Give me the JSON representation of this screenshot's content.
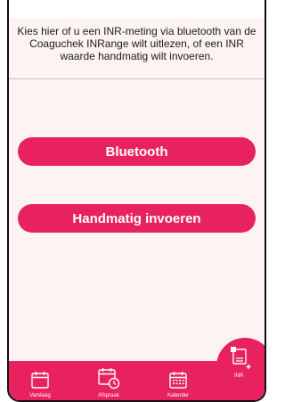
{
  "instruction_text": "Kies hier of u een INR-meting via bluetooth van de Coaguchek INRange wilt uitlezen, of een INR waarde handmatig wilt invoeren.",
  "buttons": {
    "bluetooth_label": "Bluetooth",
    "manual_label": "Handmatig invoeren"
  },
  "nav": {
    "today_label": "Vandaag",
    "appointment_label": "Afspraak",
    "calendar_label": "Kalender",
    "inr_label": "INR"
  },
  "colors": {
    "accent": "#e8215f",
    "background": "#fdf3f3"
  },
  "icons": {
    "today": "calendar-blank-icon",
    "appointment": "calendar-clock-icon",
    "calendar": "calendar-grid-icon",
    "inr": "document-plus-icon"
  }
}
